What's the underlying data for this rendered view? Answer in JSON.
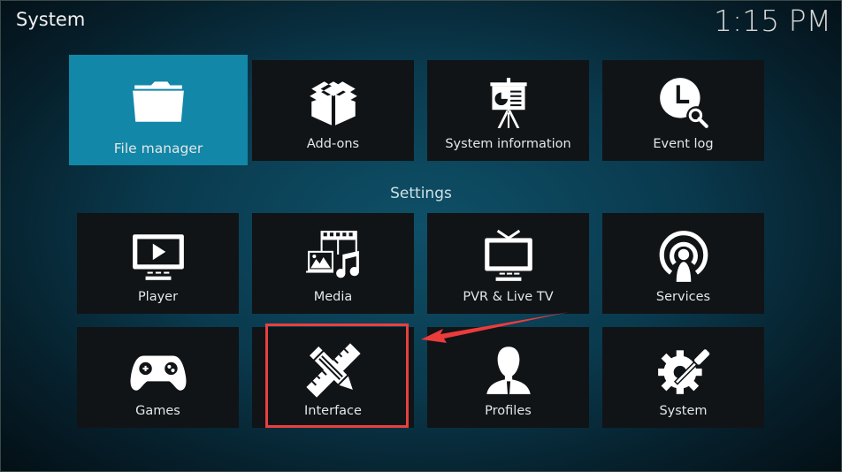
{
  "header": {
    "title": "System",
    "clock": "1:15 PM"
  },
  "top_row": [
    {
      "label": "File manager",
      "icon": "folder-icon",
      "focused": true
    },
    {
      "label": "Add-ons",
      "icon": "open-box-icon"
    },
    {
      "label": "System information",
      "icon": "presentation-easel-icon"
    },
    {
      "label": "Event log",
      "icon": "clock-search-icon"
    }
  ],
  "settings": {
    "heading": "Settings",
    "items": [
      {
        "label": "Player",
        "icon": "monitor-play-icon"
      },
      {
        "label": "Media",
        "icon": "media-filmstrip-image-music-icon"
      },
      {
        "label": "PVR & Live TV",
        "icon": "tv-antenna-icon"
      },
      {
        "label": "Services",
        "icon": "broadcast-person-icon"
      },
      {
        "label": "Games",
        "icon": "gamepad-icon"
      },
      {
        "label": "Interface",
        "icon": "pencil-ruler-icon"
      },
      {
        "label": "Profiles",
        "icon": "user-silhouette-icon"
      },
      {
        "label": "System",
        "icon": "gear-screwdriver-icon"
      }
    ]
  },
  "annotation": {
    "highlighted_item": "Interface",
    "highlight_color": "#e8403f"
  },
  "colors": {
    "focus": "#1287a8",
    "tile": "#101417",
    "background": "#0a3a4e"
  }
}
